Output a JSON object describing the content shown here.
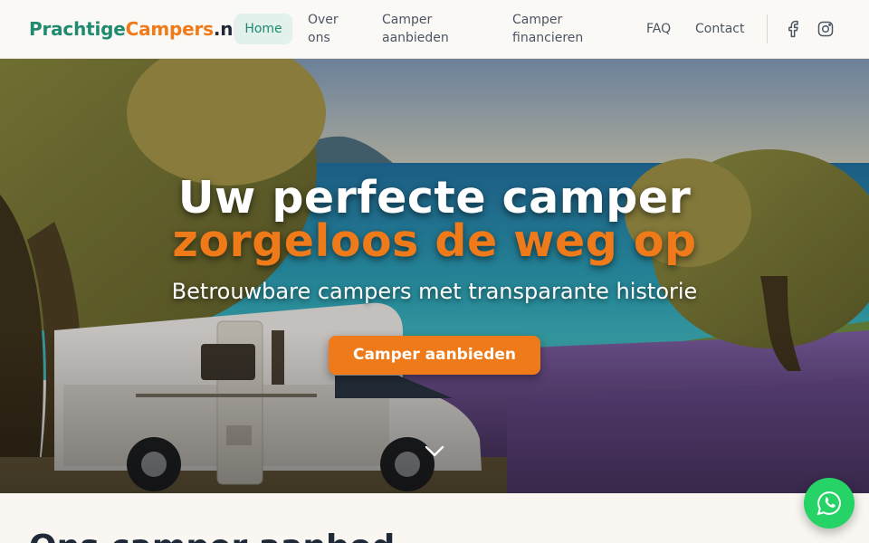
{
  "brand": {
    "part1": "Prachtige",
    "part2": "Campers",
    "part3": ".nl"
  },
  "nav": {
    "home": "Home",
    "over_line1": "Over",
    "over_line2": "ons",
    "aanbieden_line1": "Camper",
    "aanbieden_line2": "aanbieden",
    "financieren_line1": "Camper",
    "financieren_line2": "financieren",
    "faq": "FAQ",
    "contact": "Contact"
  },
  "social": {
    "facebook": "facebook-icon",
    "instagram": "instagram-icon"
  },
  "hero": {
    "title_line1": "Uw perfecte camper",
    "title_line2": "zorgeloos de weg op",
    "subtitle": "Betrouwbare campers met transparante historie",
    "cta": "Camper aanbieden",
    "scroll_icon": "chevron-down-icon"
  },
  "section": {
    "title": "Ons camper aanbod"
  },
  "colors": {
    "accent": "#ef7a1a",
    "brand_green": "#1f8a70",
    "whatsapp": "#25d366"
  },
  "fab": {
    "icon": "whatsapp-icon"
  }
}
